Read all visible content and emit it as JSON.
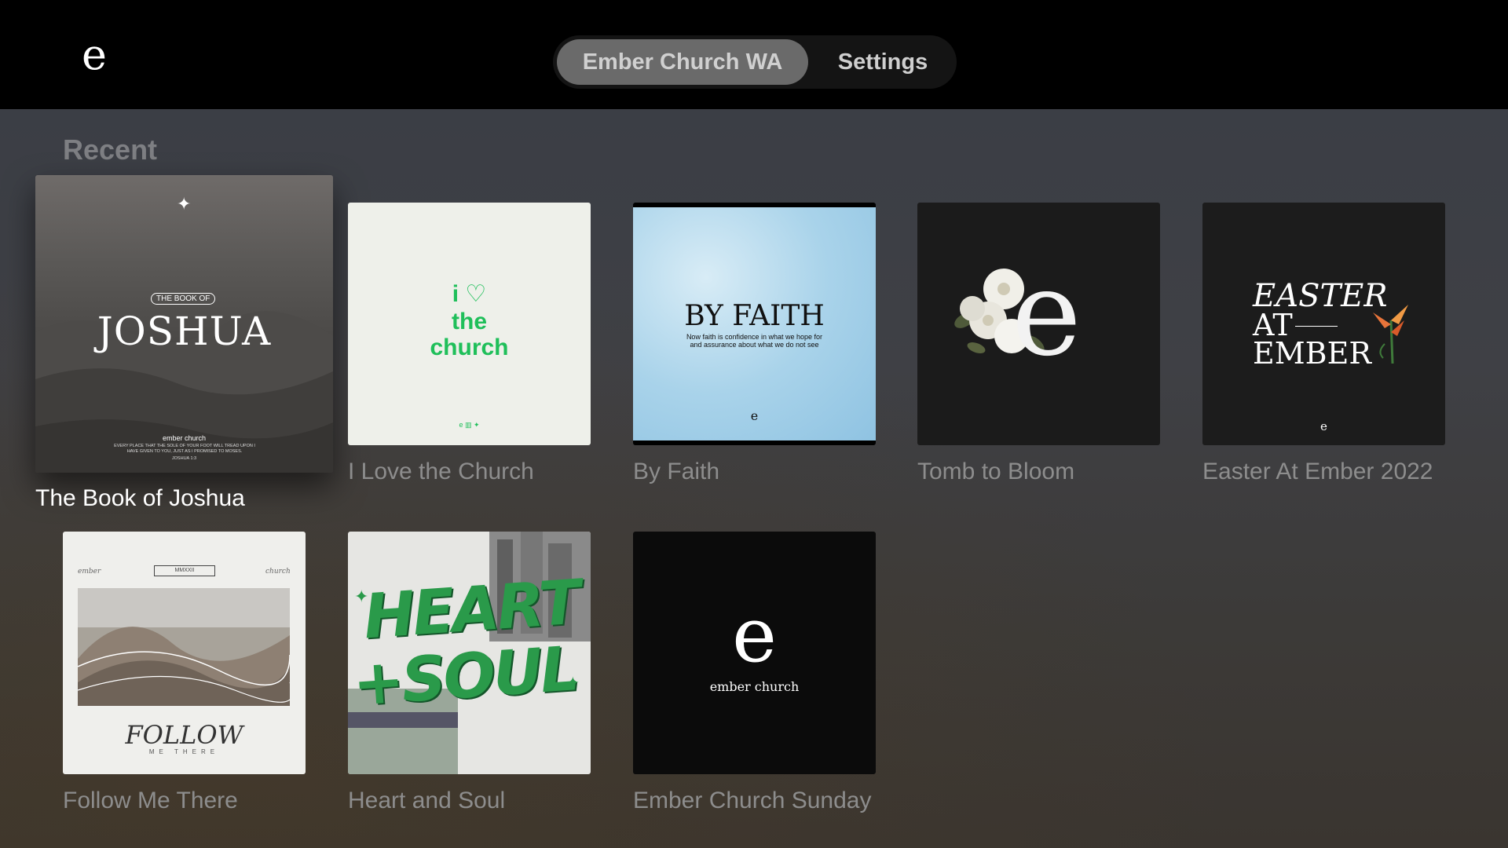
{
  "app": {
    "logo_glyph": "e"
  },
  "nav": {
    "tabs": [
      {
        "label": "Ember Church WA",
        "selected": true
      },
      {
        "label": "Settings",
        "selected": false
      }
    ]
  },
  "recent": {
    "title": "Recent",
    "items": [
      {
        "title": "The Book of Joshua",
        "focused": true,
        "art": {
          "badge": "THE BOOK OF",
          "heading": "JOSHUA",
          "org": "ember church",
          "verse": "EVERY PLACE THAT THE SOLE OF YOUR FOOT WILL TREAD UPON I HAVE GIVEN TO YOU, JUST AS I PROMISED TO MOSES.",
          "ref": "JOSHUA 1:3"
        }
      },
      {
        "title": "I Love the Church",
        "art": {
          "line1": "i",
          "line2": "the",
          "line3": "church"
        }
      },
      {
        "title": "By Faith",
        "art": {
          "heading": "BY FAITH",
          "sub1": "Now faith is confidence in what we hope for",
          "sub2": "and assurance about what we do not see"
        }
      },
      {
        "title": "Tomb to Bloom",
        "art": {
          "glyph": "e"
        }
      },
      {
        "title": "Easter At Ember 2022",
        "art": {
          "line1": "EASTER",
          "line2": "AT",
          "line3": "EMBER"
        }
      },
      {
        "title": "Follow Me There",
        "art": {
          "left": "ember",
          "badge": "MMXXII",
          "right": "church",
          "heading": "FOLLOW",
          "sub": "ME THERE"
        }
      },
      {
        "title": "Heart and Soul",
        "art": {
          "line1": "HEART",
          "line2": "+SOUL"
        }
      },
      {
        "title": "Ember Church Sunday",
        "art": {
          "glyph": "e",
          "sub": "ember church"
        }
      }
    ]
  },
  "colors": {
    "accent_green": "#1fbf5a",
    "heart_soul_green": "#2a9a4a",
    "by_faith_sky": "#a9d3ea"
  }
}
